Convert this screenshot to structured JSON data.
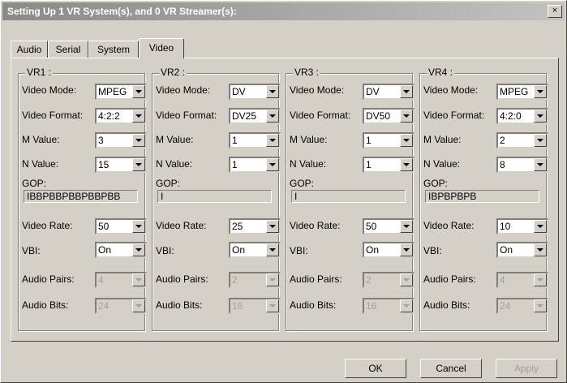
{
  "window": {
    "title": "Setting Up 1 VR System(s), and 0 VR Streamer(s):",
    "close_label": "×"
  },
  "tabs": [
    {
      "label": "Audio"
    },
    {
      "label": "Serial"
    },
    {
      "label": "System"
    },
    {
      "label": "Video",
      "active": true
    }
  ],
  "labels": {
    "video_mode": "Video Mode:",
    "video_format": "Video Format:",
    "m_value": "M Value:",
    "n_value": "N Value:",
    "gop": "GOP:",
    "video_rate": "Video Rate:",
    "vbi": "VBI:",
    "audio_pairs": "Audio Pairs:",
    "audio_bits": "Audio Bits:"
  },
  "vr": [
    {
      "title": "VR1 :",
      "video_mode": "MPEG",
      "video_format": "4:2:2",
      "m_value": "3",
      "n_value": "15",
      "gop": "IBBPBBPBBPBBPBB",
      "video_rate": "50",
      "vbi": "On",
      "audio_pairs": "4",
      "audio_bits": "24"
    },
    {
      "title": "VR2 :",
      "video_mode": "DV",
      "video_format": "DV25",
      "m_value": "1",
      "n_value": "1",
      "gop": "I",
      "video_rate": "25",
      "vbi": "On",
      "audio_pairs": "2",
      "audio_bits": "16"
    },
    {
      "title": "VR3 :",
      "video_mode": "DV",
      "video_format": "DV50",
      "m_value": "1",
      "n_value": "1",
      "gop": "I",
      "video_rate": "50",
      "vbi": "On",
      "audio_pairs": "2",
      "audio_bits": "16"
    },
    {
      "title": "VR4 :",
      "video_mode": "MPEG",
      "video_format": "4:2:0",
      "m_value": "2",
      "n_value": "8",
      "gop": "IBPBPBPB",
      "video_rate": "10",
      "vbi": "On",
      "audio_pairs": "4",
      "audio_bits": "24"
    }
  ],
  "buttons": {
    "ok": "OK",
    "cancel": "Cancel",
    "apply": "Apply"
  }
}
